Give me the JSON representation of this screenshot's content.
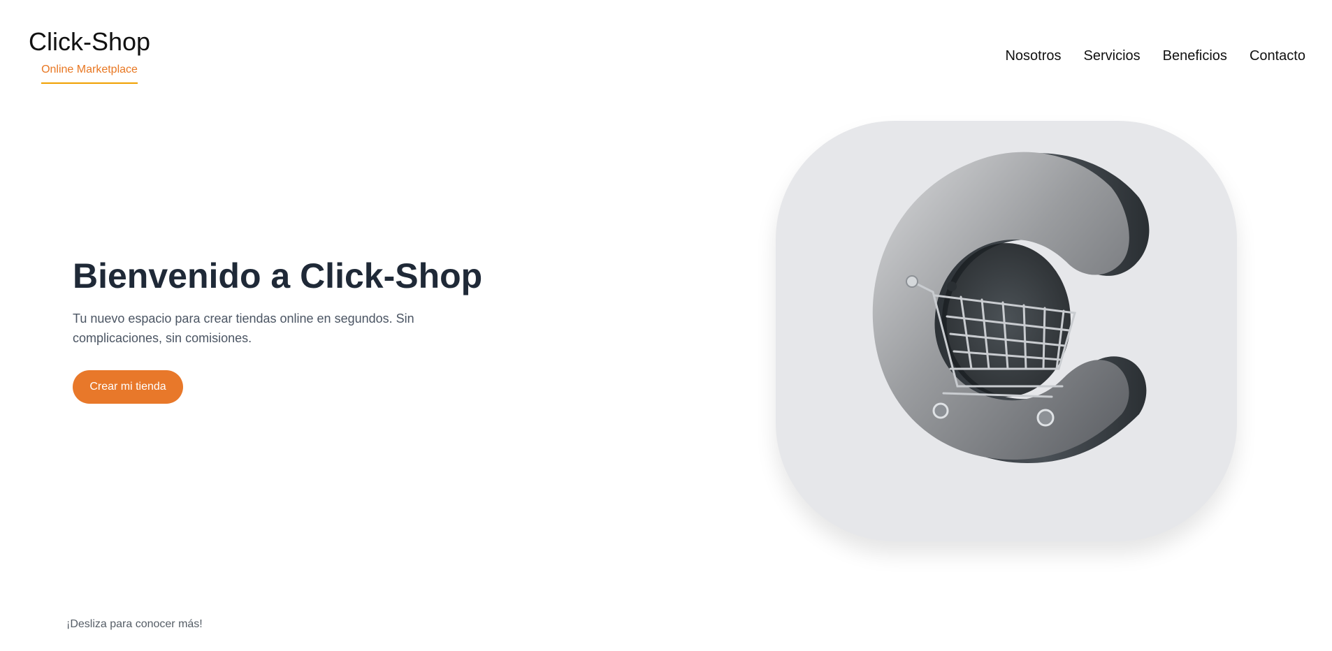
{
  "brand": {
    "title": "Click-Shop",
    "subtitle": "Online Marketplace"
  },
  "nav": {
    "items": [
      "Nosotros",
      "Servicios",
      "Beneficios",
      "Contacto"
    ]
  },
  "hero": {
    "title": "Bienvenido a Click-Shop",
    "description": "Tu nuevo espacio para crear tiendas online en segundos. Sin complicaciones, sin comisiones.",
    "cta_label": "Crear mi tienda"
  },
  "logo": {
    "icon": "c-letter-shopping-cart-logo"
  },
  "footer": {
    "scroll_hint": "¡Desliza para conocer más!"
  },
  "colors": {
    "accent": "#e8782a",
    "heading": "#1f2937",
    "card_bg": "#e6e7ea"
  }
}
